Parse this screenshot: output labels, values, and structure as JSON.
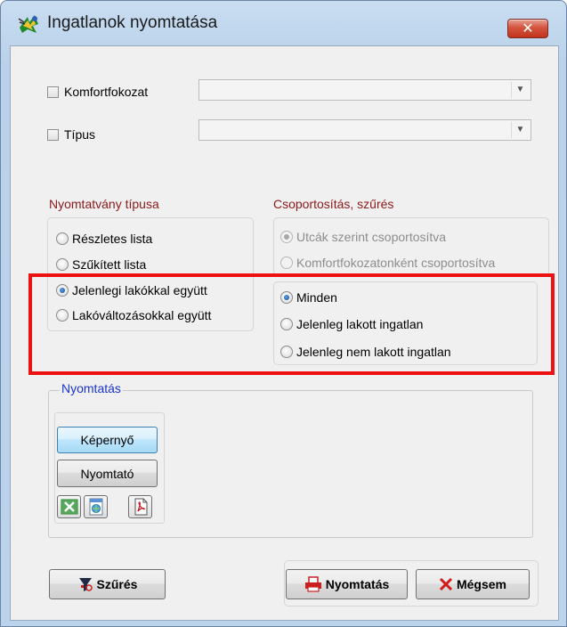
{
  "window": {
    "title": "Ingatlanok nyomtatása",
    "close_glyph": "✕"
  },
  "filters": {
    "komfort_label": "Komfortfokozat",
    "komfort_checked": false,
    "komfort_value": "",
    "tipus_label": "Típus",
    "tipus_checked": false,
    "tipus_value": ""
  },
  "nyomtatvany": {
    "title": "Nyomtatvány típusa",
    "options": [
      {
        "label": "Részletes lista",
        "checked": false
      },
      {
        "label": "Szűkített lista",
        "checked": false
      },
      {
        "label": "Jelenlegi lakókkal együtt",
        "checked": true
      },
      {
        "label": "Lakóváltozásokkal együtt",
        "checked": false
      }
    ]
  },
  "csoportositas": {
    "title": "Csoportosítás, szűrés",
    "group_options": [
      {
        "label": "Utcák szerint csoportosítva",
        "checked": true,
        "disabled": true
      },
      {
        "label": "Komfortfokozatonként csoportosítva",
        "checked": false,
        "disabled": true
      }
    ],
    "filter_options": [
      {
        "label": "Minden",
        "checked": true
      },
      {
        "label": "Jelenleg lakott ingatlan",
        "checked": false
      },
      {
        "label": "Jelenleg nem lakott ingatlan",
        "checked": false
      }
    ]
  },
  "nyomtatas": {
    "legend": "Nyomtatás",
    "screen_button": "Képernyő",
    "printer_button": "Nyomtató",
    "export_icons": [
      "excel-icon",
      "html-export-icon",
      "pdf-icon"
    ]
  },
  "footer": {
    "filter_button": "Szűrés",
    "print_button": "Nyomtatás",
    "cancel_button": "Mégsem"
  },
  "colors": {
    "group_title": "#8b1a1a",
    "legend": "#1a33cc",
    "highlight_box": "#ee1111",
    "close_button": "#c2331c"
  }
}
